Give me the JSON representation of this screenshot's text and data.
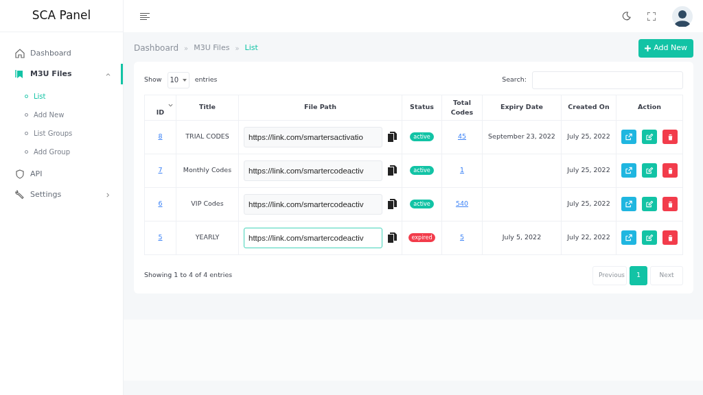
{
  "brand": "SCA Panel",
  "sidebar": {
    "items": [
      {
        "label": "Dashboard",
        "selected": false
      },
      {
        "label": "M3U Files",
        "expanded": true,
        "selected": true,
        "children": [
          {
            "label": "List",
            "selected": true
          },
          {
            "label": "Add New",
            "selected": false
          },
          {
            "label": "List Groups",
            "selected": false
          },
          {
            "label": "Add Group",
            "selected": false
          }
        ]
      },
      {
        "label": "API",
        "selected": false
      },
      {
        "label": "Settings",
        "expanded": false,
        "selected": false
      }
    ]
  },
  "breadcrumb": [
    {
      "label": "Dashboard",
      "selected": false
    },
    {
      "separator": "»",
      "label": "M3U Files",
      "selected": false
    },
    {
      "separator": "»",
      "label": "List",
      "selected": true
    }
  ],
  "add_button": "Add New",
  "length_menu": {
    "before": "Show",
    "value": "10",
    "after": "entries"
  },
  "search": {
    "label": "Search:"
  },
  "table": {
    "columns": [
      "ID",
      "Title",
      "File Path",
      "Status",
      "Total Codes",
      "Expiry Date",
      "Created On",
      "Action"
    ],
    "rows": [
      {
        "id": "8",
        "title": "TRIAL CODES",
        "file_path": "https://link.com/smartersactivatio",
        "focused": false,
        "status": {
          "label": "active",
          "color": "#12c3a5"
        },
        "total_codes": "45",
        "expiry_date": "September 23, 2022",
        "created_on": "July 25, 2022"
      },
      {
        "id": "7",
        "title": "Monthly Codes",
        "file_path": "https://link.com/smartercodeactiv",
        "focused": false,
        "status": {
          "label": "active",
          "color": "#12c3a5"
        },
        "total_codes": "1",
        "created_on": "July 25, 2022"
      },
      {
        "id": "6",
        "title": "VIP Codes",
        "file_path": "https://link.com/smartercodeactiv",
        "focused": false,
        "status": {
          "label": "active",
          "color": "#12c3a5"
        },
        "total_codes": "540",
        "created_on": "July 25, 2022"
      },
      {
        "id": "5",
        "title": "YEARLY",
        "file_path": "https://link.com/smartercodeactiv",
        "focused": true,
        "status": {
          "label": "expired",
          "color": "#f23c4b"
        },
        "total_codes": "5",
        "expiry_date": "July 5, 2022",
        "created_on": "July 22, 2022"
      }
    ]
  },
  "info": "Showing 1 to 4 of 4 entries",
  "pagination": [
    {
      "label": "Previous",
      "disabled": true,
      "selected": false
    },
    {
      "label": "1",
      "disabled": false,
      "selected": true
    },
    {
      "label": "Next",
      "disabled": true,
      "selected": false
    }
  ]
}
